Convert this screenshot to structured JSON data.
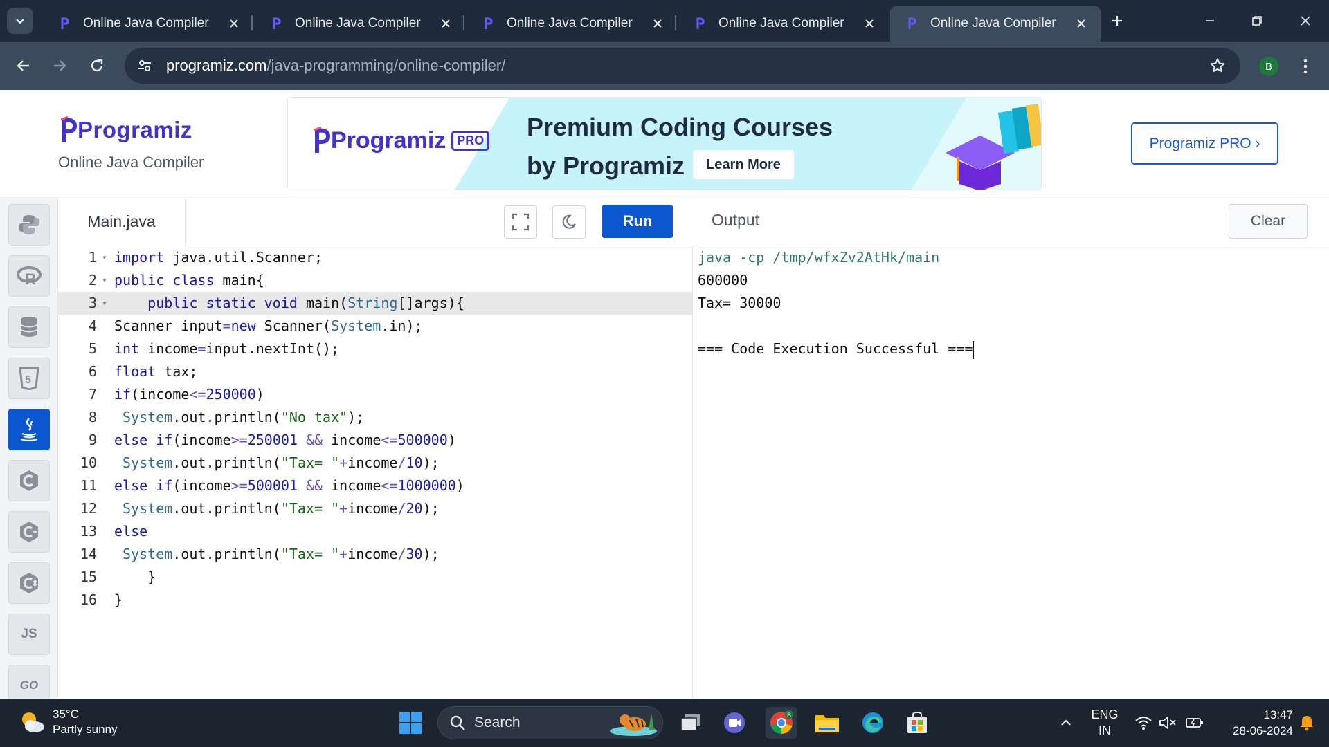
{
  "browser": {
    "tabs": [
      {
        "title": "Online Java Compiler",
        "active": false
      },
      {
        "title": "Online Java Compiler",
        "active": false
      },
      {
        "title": "Online Java Compiler",
        "active": false
      },
      {
        "title": "Online Java Compiler",
        "active": false
      },
      {
        "title": "Online Java Compiler",
        "active": true
      }
    ],
    "url_host": "programiz.com",
    "url_path": "/java-programming/online-compiler/",
    "profile_initial": "B"
  },
  "site": {
    "logo": "Programiz",
    "subtitle": "Online Java Compiler",
    "banner": {
      "logo": "Programiz",
      "badge": "PRO",
      "headline_1": "Premium Coding Courses",
      "headline_2": "by Programiz",
      "cta": "Learn More"
    },
    "pro_button": "Programiz PRO ›"
  },
  "sidebar": {
    "languages": [
      {
        "name": "python-icon",
        "label": "",
        "active": false
      },
      {
        "name": "r-icon",
        "label": "R",
        "active": false
      },
      {
        "name": "sql-icon",
        "label": "",
        "active": false
      },
      {
        "name": "html5-icon",
        "label": "5",
        "active": false
      },
      {
        "name": "java-icon",
        "label": "",
        "active": true
      },
      {
        "name": "c-icon",
        "label": "C",
        "active": false
      },
      {
        "name": "cpp-icon",
        "label": "C",
        "active": false
      },
      {
        "name": "csharp-icon",
        "label": "C",
        "active": false
      },
      {
        "name": "js-icon",
        "label": "JS",
        "active": false
      },
      {
        "name": "go-icon",
        "label": "GO",
        "active": false
      }
    ]
  },
  "editor": {
    "filename": "Main.java",
    "run_label": "Run",
    "current_line": 3,
    "lines": [
      "import java.util.Scanner;",
      "public class main{",
      "    public static void main(String[]args){",
      "Scanner input=new Scanner(System.in);",
      "int income=input.nextInt();",
      "float tax;",
      "if(income<=250000)",
      " System.out.println(\"No tax\");",
      "else if(income>=250001 && income<=500000)",
      " System.out.println(\"Tax= \"+income/10);",
      "else if(income>=500001 && income<=1000000)",
      " System.out.println(\"Tax= \"+income/20);",
      "else",
      " System.out.println(\"Tax= \"+income/30);",
      "    }",
      "}"
    ],
    "folds": [
      1,
      2,
      3
    ]
  },
  "output": {
    "title": "Output",
    "clear_label": "Clear",
    "lines": [
      "java -cp /tmp/wfxZv2AtHk/main",
      "600000",
      "Tax= 30000",
      "",
      "=== Code Execution Successful ==="
    ]
  },
  "taskbar": {
    "temperature": "35°C",
    "condition": "Partly sunny",
    "search_placeholder": "Search",
    "language": "ENG",
    "region": "IN",
    "time": "13:47",
    "date": "28-06-2024"
  },
  "colors": {
    "accent": "#0b57d0",
    "brand": "#4433c9",
    "tab_bg": "#1f2b3b",
    "toolbar_bg": "#3c4a5d"
  }
}
